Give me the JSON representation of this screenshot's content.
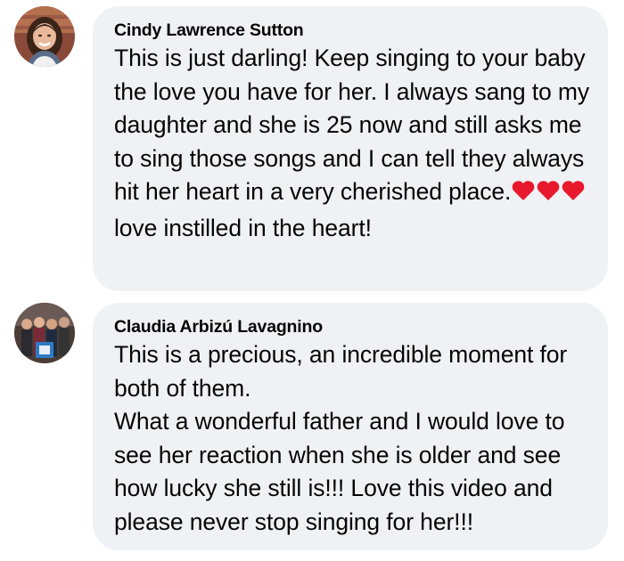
{
  "comments": [
    {
      "author": "Cindy Lawrence Sutton",
      "avatar_icon": "profile-photo-woman",
      "text_before_emoji": "This is just darling! Keep singing to your baby the love you have for her. I always sang to my daughter and she is 25 now and still asks me to sing those songs and I can tell they always hit her heart in a very cherished place.",
      "emoji": "❤️❤️❤️",
      "text_after_emoji": " love instilled in the heart!"
    },
    {
      "author": "Claudia Arbizú Lavagnino",
      "avatar_icon": "profile-photo-group",
      "text_para1": "This is a precious, an incredible moment for both of them.",
      "text_para2": "What a wonderful father and I would love to see her reaction when she is older and see how lucky she still is!!! Love this video and please never stop singing for her!!!"
    }
  ],
  "colors": {
    "bubble_bg": "#eff1f4",
    "text": "#050505",
    "heart": "#e8192c"
  }
}
